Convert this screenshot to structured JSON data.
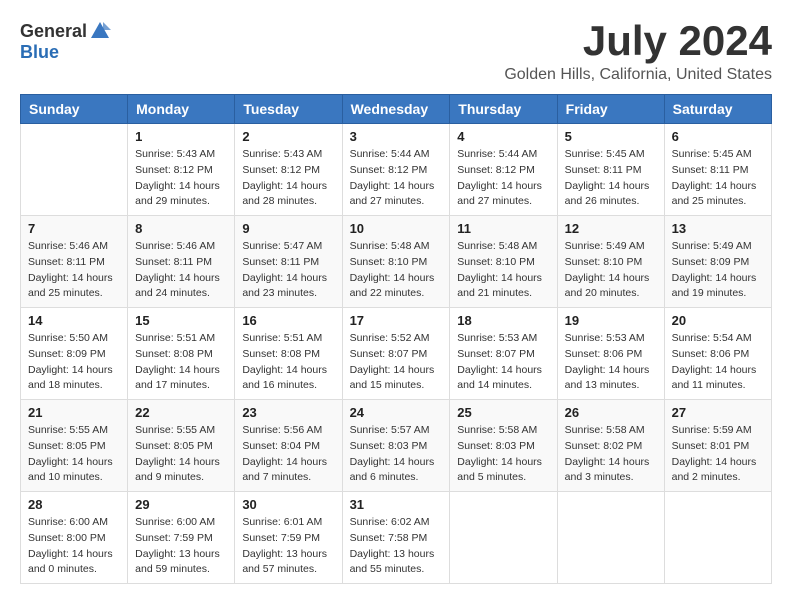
{
  "header": {
    "logo_general": "General",
    "logo_blue": "Blue",
    "month_title": "July 2024",
    "location": "Golden Hills, California, United States"
  },
  "calendar": {
    "days_of_week": [
      "Sunday",
      "Monday",
      "Tuesday",
      "Wednesday",
      "Thursday",
      "Friday",
      "Saturday"
    ],
    "weeks": [
      [
        {
          "day": "",
          "info": ""
        },
        {
          "day": "1",
          "info": "Sunrise: 5:43 AM\nSunset: 8:12 PM\nDaylight: 14 hours\nand 29 minutes."
        },
        {
          "day": "2",
          "info": "Sunrise: 5:43 AM\nSunset: 8:12 PM\nDaylight: 14 hours\nand 28 minutes."
        },
        {
          "day": "3",
          "info": "Sunrise: 5:44 AM\nSunset: 8:12 PM\nDaylight: 14 hours\nand 27 minutes."
        },
        {
          "day": "4",
          "info": "Sunrise: 5:44 AM\nSunset: 8:12 PM\nDaylight: 14 hours\nand 27 minutes."
        },
        {
          "day": "5",
          "info": "Sunrise: 5:45 AM\nSunset: 8:11 PM\nDaylight: 14 hours\nand 26 minutes."
        },
        {
          "day": "6",
          "info": "Sunrise: 5:45 AM\nSunset: 8:11 PM\nDaylight: 14 hours\nand 25 minutes."
        }
      ],
      [
        {
          "day": "7",
          "info": "Sunrise: 5:46 AM\nSunset: 8:11 PM\nDaylight: 14 hours\nand 25 minutes."
        },
        {
          "day": "8",
          "info": "Sunrise: 5:46 AM\nSunset: 8:11 PM\nDaylight: 14 hours\nand 24 minutes."
        },
        {
          "day": "9",
          "info": "Sunrise: 5:47 AM\nSunset: 8:11 PM\nDaylight: 14 hours\nand 23 minutes."
        },
        {
          "day": "10",
          "info": "Sunrise: 5:48 AM\nSunset: 8:10 PM\nDaylight: 14 hours\nand 22 minutes."
        },
        {
          "day": "11",
          "info": "Sunrise: 5:48 AM\nSunset: 8:10 PM\nDaylight: 14 hours\nand 21 minutes."
        },
        {
          "day": "12",
          "info": "Sunrise: 5:49 AM\nSunset: 8:10 PM\nDaylight: 14 hours\nand 20 minutes."
        },
        {
          "day": "13",
          "info": "Sunrise: 5:49 AM\nSunset: 8:09 PM\nDaylight: 14 hours\nand 19 minutes."
        }
      ],
      [
        {
          "day": "14",
          "info": "Sunrise: 5:50 AM\nSunset: 8:09 PM\nDaylight: 14 hours\nand 18 minutes."
        },
        {
          "day": "15",
          "info": "Sunrise: 5:51 AM\nSunset: 8:08 PM\nDaylight: 14 hours\nand 17 minutes."
        },
        {
          "day": "16",
          "info": "Sunrise: 5:51 AM\nSunset: 8:08 PM\nDaylight: 14 hours\nand 16 minutes."
        },
        {
          "day": "17",
          "info": "Sunrise: 5:52 AM\nSunset: 8:07 PM\nDaylight: 14 hours\nand 15 minutes."
        },
        {
          "day": "18",
          "info": "Sunrise: 5:53 AM\nSunset: 8:07 PM\nDaylight: 14 hours\nand 14 minutes."
        },
        {
          "day": "19",
          "info": "Sunrise: 5:53 AM\nSunset: 8:06 PM\nDaylight: 14 hours\nand 13 minutes."
        },
        {
          "day": "20",
          "info": "Sunrise: 5:54 AM\nSunset: 8:06 PM\nDaylight: 14 hours\nand 11 minutes."
        }
      ],
      [
        {
          "day": "21",
          "info": "Sunrise: 5:55 AM\nSunset: 8:05 PM\nDaylight: 14 hours\nand 10 minutes."
        },
        {
          "day": "22",
          "info": "Sunrise: 5:55 AM\nSunset: 8:05 PM\nDaylight: 14 hours\nand 9 minutes."
        },
        {
          "day": "23",
          "info": "Sunrise: 5:56 AM\nSunset: 8:04 PM\nDaylight: 14 hours\nand 7 minutes."
        },
        {
          "day": "24",
          "info": "Sunrise: 5:57 AM\nSunset: 8:03 PM\nDaylight: 14 hours\nand 6 minutes."
        },
        {
          "day": "25",
          "info": "Sunrise: 5:58 AM\nSunset: 8:03 PM\nDaylight: 14 hours\nand 5 minutes."
        },
        {
          "day": "26",
          "info": "Sunrise: 5:58 AM\nSunset: 8:02 PM\nDaylight: 14 hours\nand 3 minutes."
        },
        {
          "day": "27",
          "info": "Sunrise: 5:59 AM\nSunset: 8:01 PM\nDaylight: 14 hours\nand 2 minutes."
        }
      ],
      [
        {
          "day": "28",
          "info": "Sunrise: 6:00 AM\nSunset: 8:00 PM\nDaylight: 14 hours\nand 0 minutes."
        },
        {
          "day": "29",
          "info": "Sunrise: 6:00 AM\nSunset: 7:59 PM\nDaylight: 13 hours\nand 59 minutes."
        },
        {
          "day": "30",
          "info": "Sunrise: 6:01 AM\nSunset: 7:59 PM\nDaylight: 13 hours\nand 57 minutes."
        },
        {
          "day": "31",
          "info": "Sunrise: 6:02 AM\nSunset: 7:58 PM\nDaylight: 13 hours\nand 55 minutes."
        },
        {
          "day": "",
          "info": ""
        },
        {
          "day": "",
          "info": ""
        },
        {
          "day": "",
          "info": ""
        }
      ]
    ]
  }
}
